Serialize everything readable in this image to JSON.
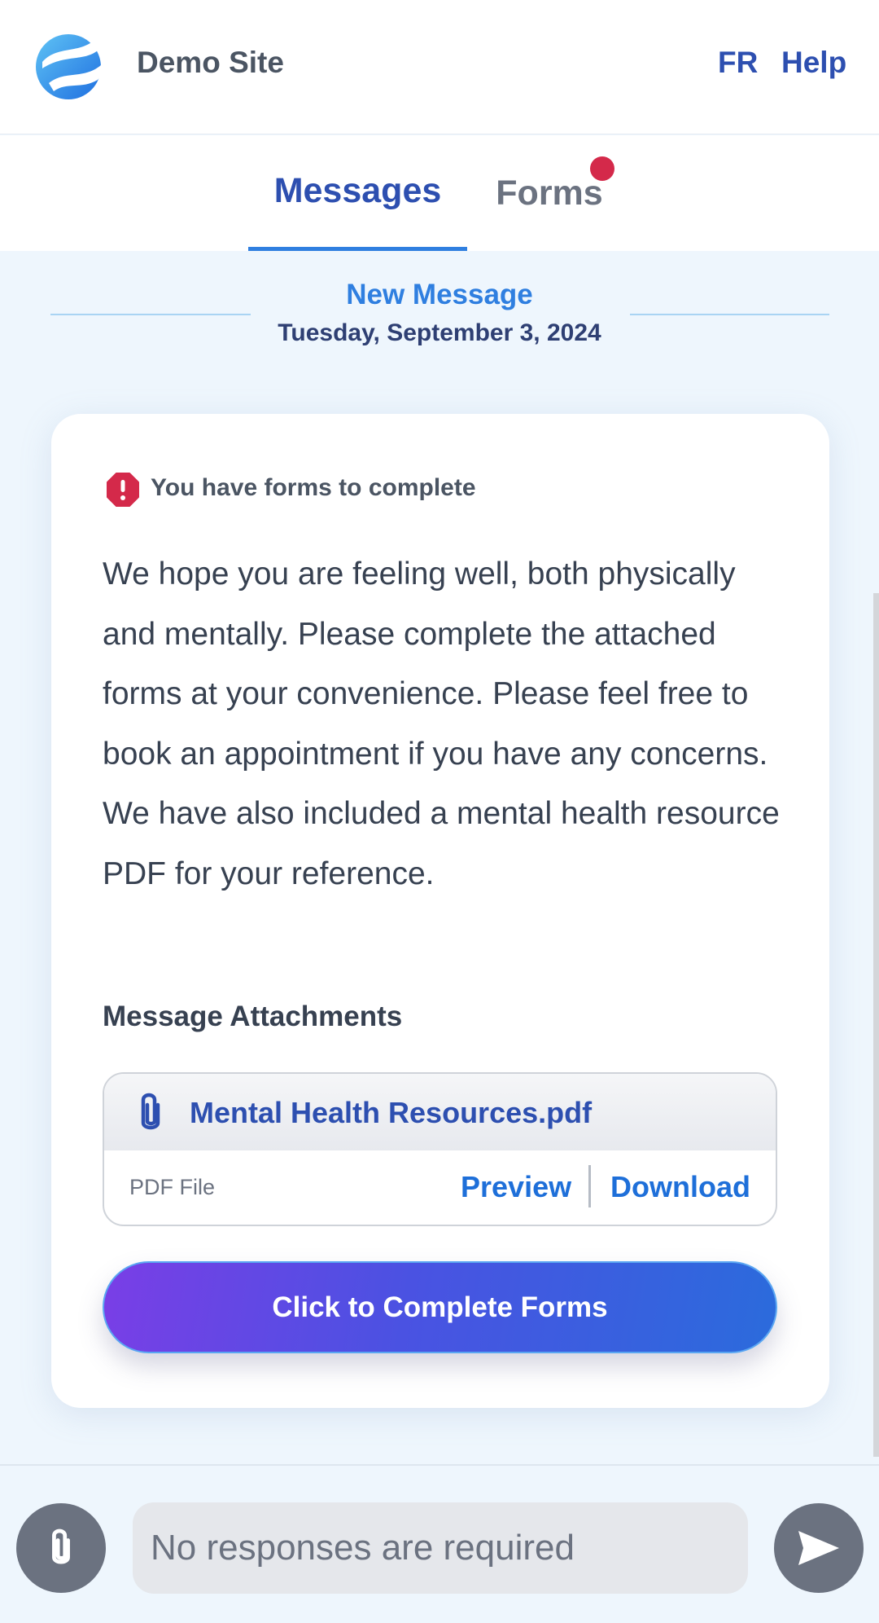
{
  "header": {
    "site_name": "Demo Site",
    "language_link": "FR",
    "help_link": "Help",
    "logo_icon": "globe-swirl-logo"
  },
  "tabs": [
    {
      "label": "Messages",
      "active": true
    },
    {
      "label": "Forms",
      "active": false,
      "has_notification": true
    }
  ],
  "message": {
    "heading": "New Message",
    "date": "Tuesday, September 3, 2024",
    "alert_icon": "alert-octagon-icon",
    "alert_text": "You have forms to complete",
    "body": "We hope you are feeling well, both physically and mentally. Please complete the attached forms at your convenience. Please feel free to book an appointment if you have any concerns. We have also included a mental health resource PDF for your reference.",
    "attachments_heading": "Message Attachments",
    "attachment": {
      "icon": "paperclip-icon",
      "name": "Mental Health Resources.pdf",
      "type": "PDF File",
      "preview_label": "Preview",
      "download_label": "Download"
    },
    "complete_button": "Click to Complete Forms"
  },
  "composer": {
    "attach_icon": "paperclip-icon",
    "placeholder": "No responses are required",
    "send_icon": "send-icon"
  },
  "colors": {
    "brand_blue": "#2d4fb0",
    "accent_blue": "#2f7fe0",
    "alert_red": "#d4294a",
    "button_gradient_start": "#7a3ee6",
    "button_gradient_end": "#2b6bdc",
    "page_background": "#eef6fd"
  }
}
